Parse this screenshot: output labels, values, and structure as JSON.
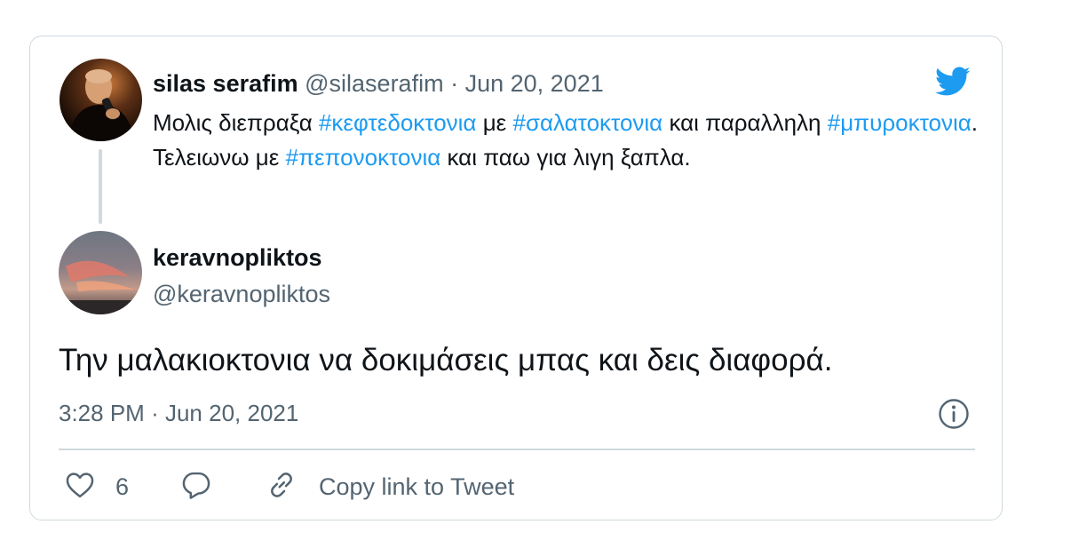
{
  "quoted_tweet": {
    "author_name": "silas serafim",
    "author_handle": "@silaserafim",
    "separator": "·",
    "date": "Jun 20, 2021",
    "text_segments": [
      {
        "text": "Μολις διεπραξα ",
        "type": "text"
      },
      {
        "text": "#κεφτεδοκτονια",
        "type": "hashtag"
      },
      {
        "text": " με ",
        "type": "text"
      },
      {
        "text": "#σαλατοκτονια",
        "type": "hashtag"
      },
      {
        "text": " και παραλληλη ",
        "type": "text"
      },
      {
        "text": "#μπυροκτονια",
        "type": "hashtag"
      },
      {
        "text": ". Τελειωνω με ",
        "type": "text"
      },
      {
        "text": "#πεπονοκτονια",
        "type": "hashtag"
      },
      {
        "text": " και παω για λιγη ξαπλα.",
        "type": "text"
      }
    ]
  },
  "reply_tweet": {
    "author_name": "keravnopliktos",
    "author_handle": "@keravnopliktos",
    "text": "Την μαλακιοκτονια να δοκιμάσεις μπας και δεις διαφορά.",
    "time": "3:28 PM",
    "separator": "·",
    "date": "Jun 20, 2021"
  },
  "actions": {
    "like_count": "6",
    "copy_link_label": "Copy link to Tweet"
  },
  "icons": {
    "brand": "twitter-bird-icon",
    "info": "info-icon",
    "like": "heart-icon",
    "reply": "reply-bubble-icon",
    "copy": "link-icon"
  },
  "colors": {
    "twitter_blue": "#1d9bf0",
    "text_primary": "#0f1419",
    "text_muted": "#536471",
    "border": "#cfd9de"
  }
}
